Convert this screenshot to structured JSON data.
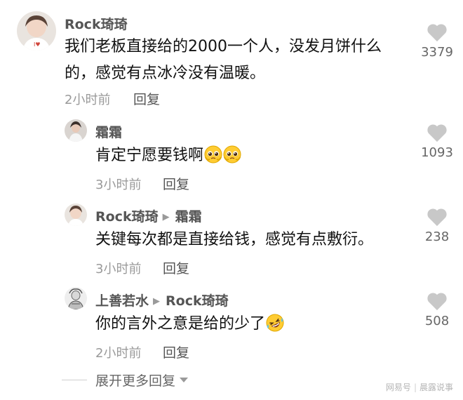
{
  "comments": [
    {
      "author": "Rock琦琦",
      "text_lines": [
        "我们老板直接给的2000一个人，没发月饼什么",
        "的，感觉有点冰冷没有温暖。"
      ],
      "time": "2小时前",
      "reply_label": "回复",
      "likes": "3379"
    },
    {
      "author": "霜霜",
      "text": "肯定宁愿要钱啊",
      "emojis": [
        "pleading-face-emoji",
        "pleading-face-emoji"
      ],
      "time": "3小时前",
      "reply_label": "回复",
      "likes": "1093"
    },
    {
      "author": "Rock琦琦",
      "reply_to": "霜霜",
      "text": "关键每次都是直接给钱，感觉有点敷衍。",
      "time": "3小时前",
      "reply_label": "回复",
      "likes": "238"
    },
    {
      "author": "上善若水",
      "reply_to": "Rock琦琦",
      "text": "你的言外之意是给的少了",
      "emojis": [
        "rolling-laughing-emoji"
      ],
      "time": "2小时前",
      "reply_label": "回复",
      "likes": "508"
    }
  ],
  "expand_label": "展开更多回复",
  "watermark": {
    "left": "网易号",
    "right": "晨露说事"
  },
  "icons": {
    "like": "heart-icon",
    "reply_arrow": "reply-arrow-icon",
    "expand": "caret-down-icon"
  },
  "colors": {
    "author": "#555555",
    "meta": "#9a9a9a",
    "heart": "#c8c8c8"
  }
}
